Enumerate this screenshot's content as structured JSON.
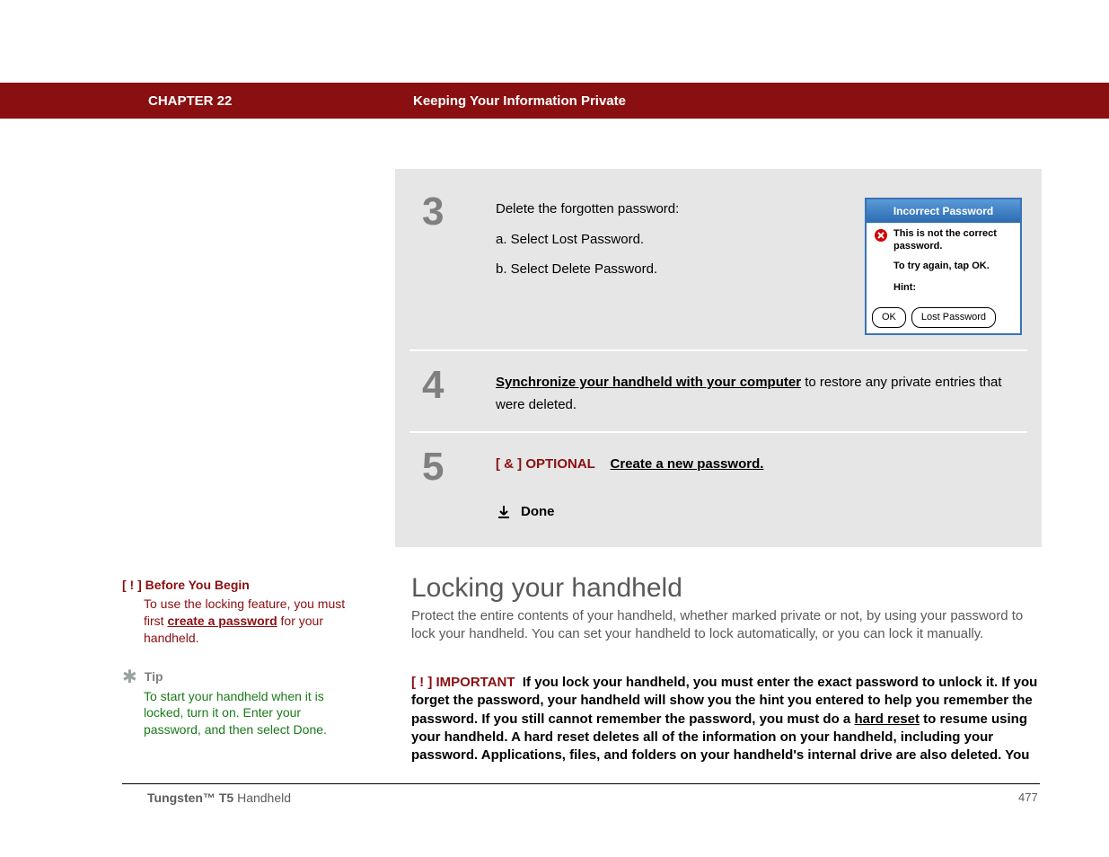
{
  "header": {
    "chapter": "CHAPTER 22",
    "title": "Keeping Your Information Private"
  },
  "steps": {
    "s3": {
      "num": "3",
      "intro": "Delete the forgotten password:",
      "a": "a.  Select Lost Password.",
      "b": "b.  Select Delete Password."
    },
    "dialog": {
      "title": "Incorrect Password",
      "msg": "This is not the correct password.",
      "retry": "To try again, tap OK.",
      "hint": "Hint:",
      "ok": "OK",
      "lost": "Lost Password"
    },
    "s4": {
      "num": "4",
      "link": "Synchronize your handheld with your computer",
      "rest": " to restore any private entries that were deleted."
    },
    "s5": {
      "num": "5",
      "opt": "[ & ]  OPTIONAL",
      "link": "Create a new password.",
      "done": "Done"
    }
  },
  "heading": "Locking your handheld",
  "para": "Protect the entire contents of your handheld, whether marked private or not, by using your password to lock your handheld. You can set your handheld to lock automatically, or you can lock it manually.",
  "important": {
    "marker": "[ ! ] IMPORTANT",
    "t1": "If you lock your handheld, you must enter the exact password to unlock it. If you forget the password, your handheld will show you the hint you entered to help you remember the password. If you still cannot remember the password, you must do a ",
    "link": "hard reset",
    "t2": " to resume using your handheld. A hard reset deletes all of the information on your handheld, including your password. Applications, files, and folders on your handheld's internal drive are also deleted. You"
  },
  "sidebar": {
    "byb_marker": "[ ! ]",
    "byb_title": "Before You Begin",
    "byb_t1": "To use the locking feature, you must first ",
    "byb_link": "create a password",
    "byb_t2": " for your handheld.",
    "tip_label": "Tip",
    "tip_body": "To start your handheld when it is locked, turn it on. Enter your password, and then select Done."
  },
  "footer": {
    "prod1": "Tungsten™ T5",
    "prod2": " Handheld",
    "page": "477"
  }
}
